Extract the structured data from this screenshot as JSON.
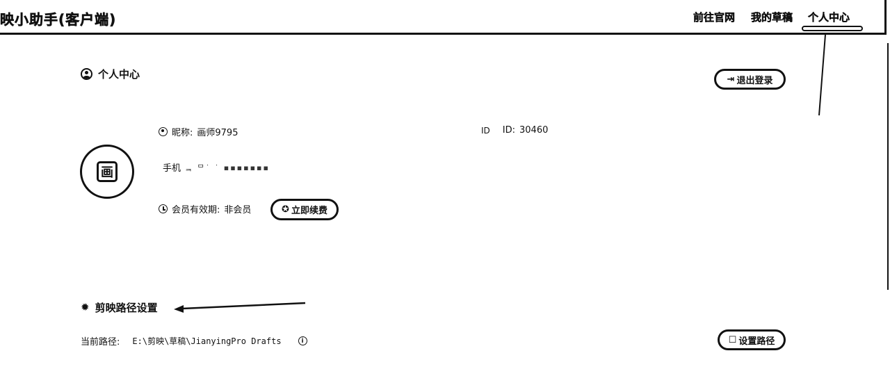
{
  "app": {
    "title": "映小助手(客户端)"
  },
  "nav": {
    "official_site": "前往官网",
    "my_drafts": "我的草稿",
    "profile": "个人中心"
  },
  "profile": {
    "heading": "个人中心",
    "logout_label": "退出登录",
    "avatar_glyph": "画",
    "nickname_label": "昵称:",
    "nickname_value": "画师9795",
    "id_icon_text": "ID",
    "id_label": "ID:",
    "id_value": "30460",
    "phone_label": "手机",
    "phone_masked": "ᆿ ᄆ˙  ˙ ▪▪▪▪▪▪▪",
    "membership_label": "会员有效期:",
    "membership_value": "非会员",
    "renew_label": "立即续费"
  },
  "path_settings": {
    "heading": "剪映路径设置",
    "current_path_label": "当前路径:",
    "current_path_value": "E:\\剪映\\草稿\\JianyingPro Drafts",
    "set_path_label": "设置路径"
  }
}
